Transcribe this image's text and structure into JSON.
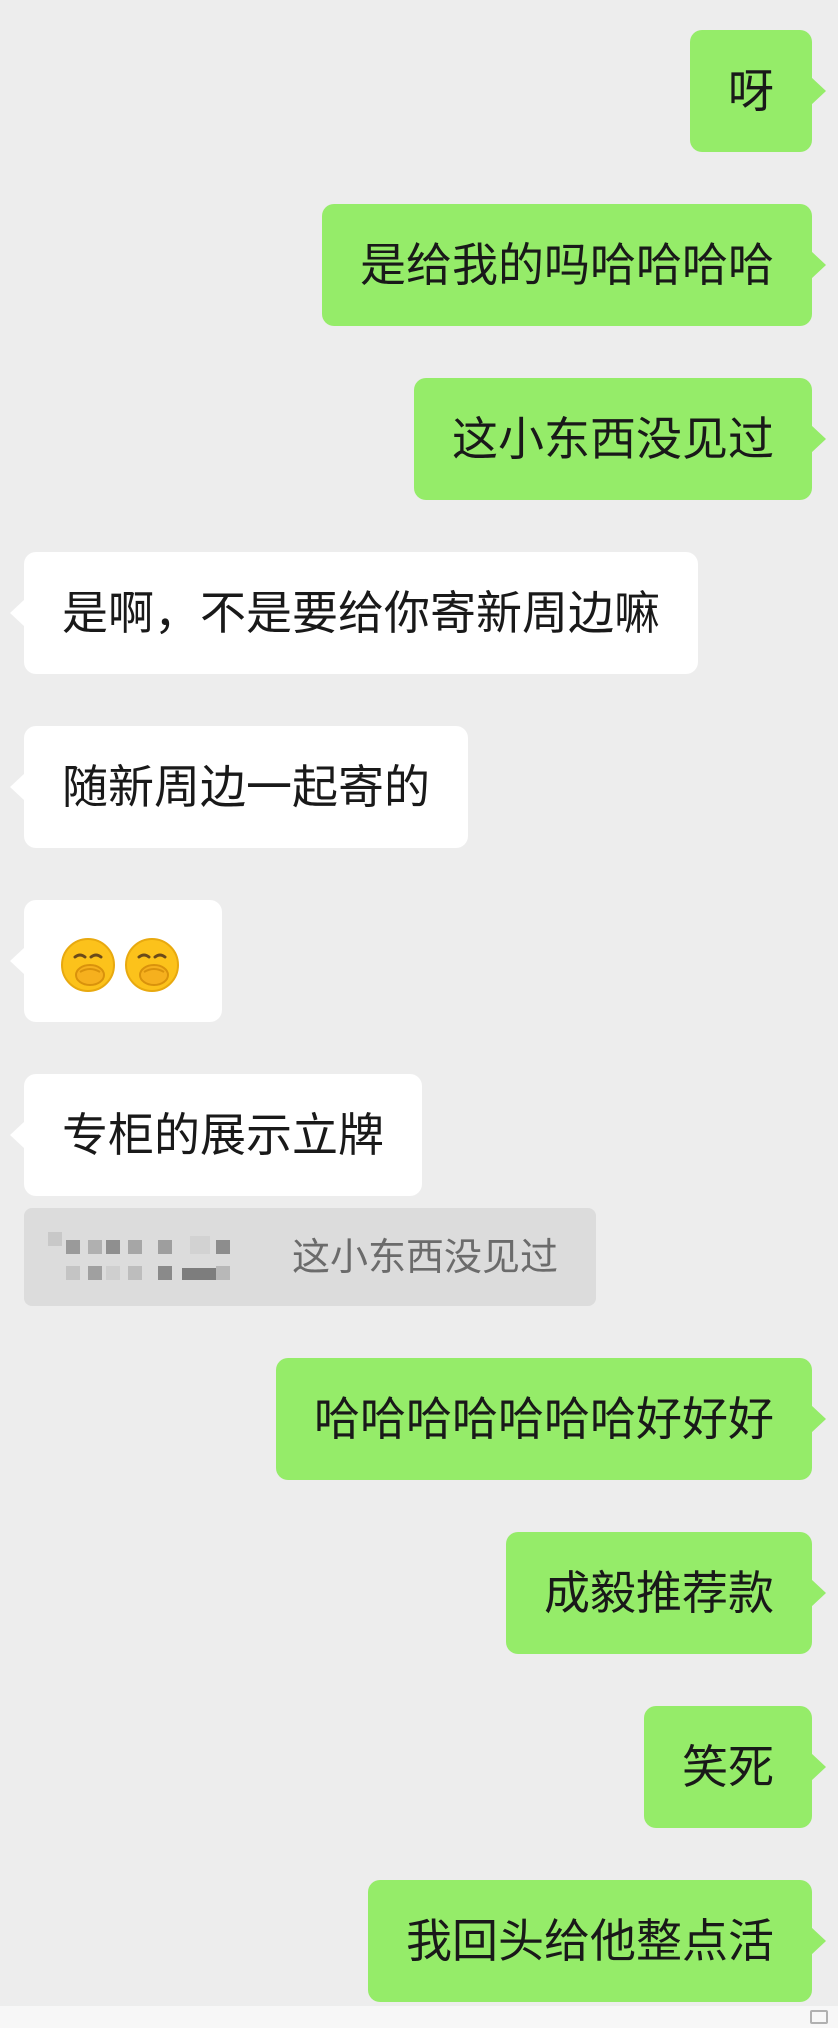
{
  "messages": [
    {
      "side": "out",
      "text": "呀"
    },
    {
      "side": "out",
      "text": "是给我的吗哈哈哈哈"
    },
    {
      "side": "out",
      "text": "这小东西没见过"
    },
    {
      "side": "in",
      "text": "是啊，不是要给你寄新周边嘛"
    },
    {
      "side": "in",
      "text": "随新周边一起寄的"
    },
    {
      "side": "in",
      "emoji": "hand-over-mouth-face-icon",
      "emoji_count": 2
    },
    {
      "side": "in",
      "text": "专柜的展示立牌"
    },
    {
      "side": "out",
      "text": "哈哈哈哈哈哈哈好好好"
    },
    {
      "side": "out",
      "text": "成毅推荐款"
    },
    {
      "side": "out",
      "text": "笑死"
    },
    {
      "side": "out",
      "text": "我回头给他整点活"
    }
  ],
  "quote": {
    "text": "这小东西没见过",
    "sender_name_icon": "pixelated-name-icon"
  },
  "colors": {
    "background": "#ededed",
    "outgoing_bubble": "#95ec69",
    "incoming_bubble": "#ffffff",
    "quote_background": "#dcdcdc",
    "quote_text": "#6b6b6b"
  }
}
